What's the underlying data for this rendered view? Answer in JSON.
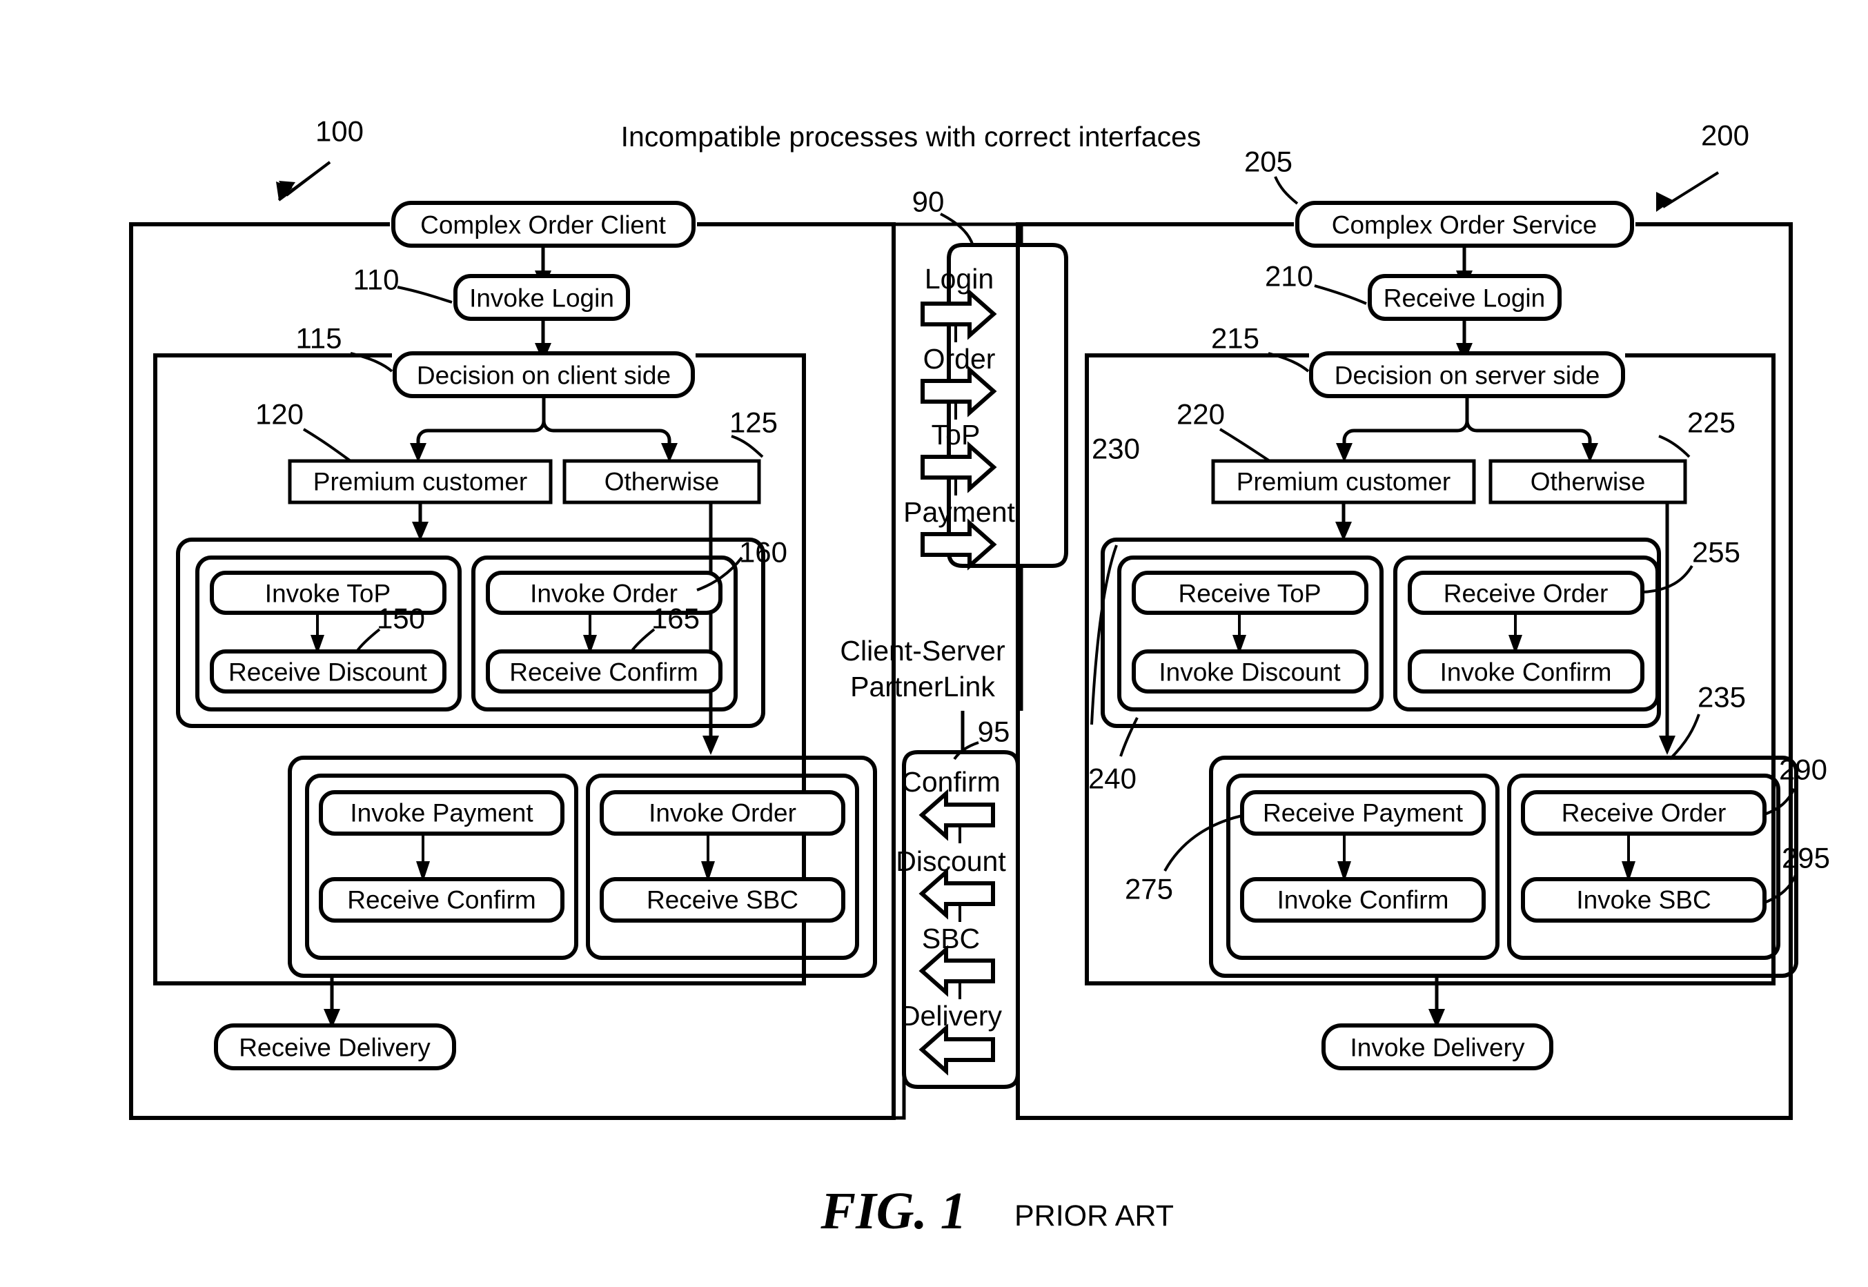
{
  "figure": {
    "title": "Incompatible processes with correct interfaces",
    "caption_number": "FIG. 1",
    "caption_note": "PRIOR ART"
  },
  "client": {
    "ref": "100",
    "root_label": "Complex Order Client",
    "nodes": {
      "login": {
        "ref": "110",
        "label": "Invoke Login"
      },
      "decision": {
        "ref": "115",
        "label": "Decision on client side"
      },
      "premium": {
        "ref": "120",
        "label": "Premium customer"
      },
      "otherwise": {
        "ref": "125",
        "label": "Otherwise"
      },
      "invoke_top": {
        "label": "Invoke ToP"
      },
      "receive_discount": {
        "ref": "150",
        "label": "Receive Discount"
      },
      "invoke_order_top": {
        "ref": "160",
        "label": "Invoke Order"
      },
      "receive_confirm_top": {
        "ref": "165",
        "label": "Receive Confirm"
      },
      "invoke_payment": {
        "label": "Invoke Payment"
      },
      "receive_confirm_bottom": {
        "label": "Receive Confirm"
      },
      "invoke_order_bottom": {
        "label": "Invoke Order"
      },
      "receive_sbc": {
        "label": "Receive SBC"
      },
      "receive_delivery": {
        "label": "Receive Delivery"
      }
    }
  },
  "server": {
    "ref": "200",
    "root_ref": "205",
    "root_label": "Complex Order Service",
    "nodes": {
      "login": {
        "ref": "210",
        "label": "Receive Login"
      },
      "decision": {
        "ref": "215",
        "label": "Decision on server side"
      },
      "premium": {
        "ref": "220",
        "label": "Premium customer"
      },
      "otherwise": {
        "ref": "225",
        "label": "Otherwise"
      },
      "scope_top": {
        "ref": "230"
      },
      "scope_bottom": {
        "ref": "235"
      },
      "scope_outer": {
        "ref": "240"
      },
      "receive_top": {
        "label": "Receive ToP"
      },
      "invoke_discount": {
        "label": "Invoke Discount"
      },
      "receive_order_top": {
        "ref": "255",
        "label": "Receive Order"
      },
      "invoke_confirm_top": {
        "label": "Invoke Confirm"
      },
      "receive_payment": {
        "ref": "275",
        "label": "Receive Payment"
      },
      "invoke_confirm_bottom": {
        "label": "Invoke Confirm"
      },
      "receive_order_bottom": {
        "ref": "290",
        "label": "Receive Order"
      },
      "invoke_sbc": {
        "ref": "295",
        "label": "Invoke SBC"
      },
      "invoke_delivery": {
        "label": "Invoke Delivery"
      }
    }
  },
  "partnerlink": {
    "label": "Client-Server PartnerLink",
    "label_line1": "Client-Server",
    "label_line2": "PartnerLink",
    "request_ref": "90",
    "response_ref": "95",
    "request_messages": [
      "Login",
      "Order",
      "ToP",
      "Payment"
    ],
    "response_messages": [
      "Confirm",
      "Discount",
      "SBC",
      "Delivery"
    ]
  }
}
